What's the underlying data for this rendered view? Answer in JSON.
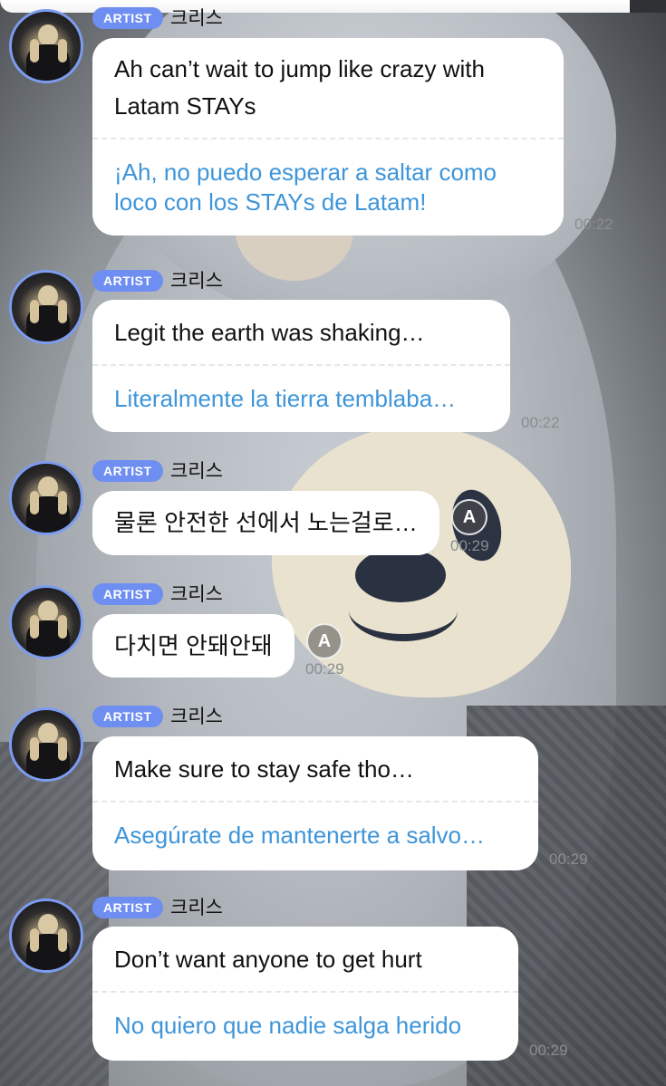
{
  "badge_label": "ARTIST",
  "artist_name": "크리스",
  "translate_icon_glyph": "A",
  "colors": {
    "badge": "#6f8ef2",
    "translation_text": "#3e95d9",
    "avatar_ring": "#7d9cf0"
  },
  "messages": [
    {
      "original": [
        "Ah can’t wait to jump like crazy with",
        "Latam STAYs"
      ],
      "translation": [
        "¡Ah, no puedo esperar a saltar como",
        "loco con los STAYs de Latam!"
      ],
      "time": "00:22"
    },
    {
      "original": [
        "Legit the earth was shaking…"
      ],
      "translation": [
        "Literalmente la tierra temblaba…"
      ],
      "time": "00:22"
    },
    {
      "original": [
        "물론 안전한 선에서 노는걸로…"
      ],
      "time": "00:29",
      "translate_button": "translate-icon"
    },
    {
      "original": [
        "다치면 안돼안돼"
      ],
      "time": "00:29",
      "translate_button": "translate-icon"
    },
    {
      "original": [
        "Make sure to stay safe tho…"
      ],
      "translation": [
        "Asegúrate de mantenerte a salvo…"
      ],
      "time": "00:29"
    },
    {
      "original": [
        "Don’t want anyone to get hurt"
      ],
      "translation": [
        "No quiero que nadie salga herido"
      ],
      "time": "00:29"
    }
  ]
}
